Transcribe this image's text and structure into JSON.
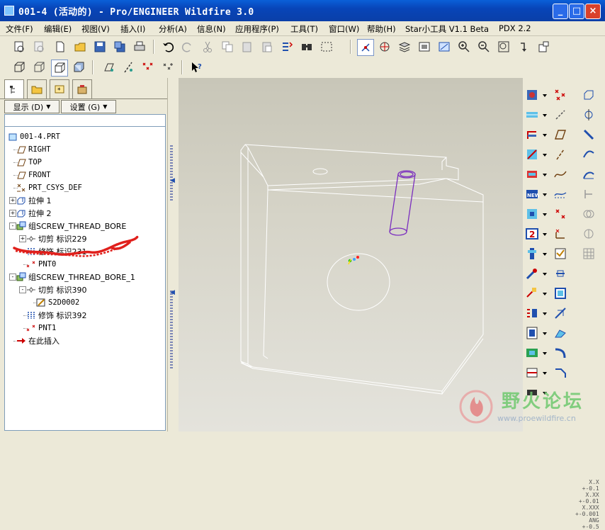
{
  "window": {
    "title": "001-4 (活动的) - Pro/ENGINEER Wildfire 3.0",
    "minimize": "_",
    "maximize": "□",
    "close": "×"
  },
  "menu": [
    "文件(F)",
    "编辑(E)",
    "视图(V)",
    "插入(I)",
    "分析(A)",
    "信息(N)",
    "应用程序(P)",
    "工具(T)",
    "窗口(W)",
    "帮助(H)",
    "Star小工具 V1.1 Beta",
    "PDX 2.2"
  ],
  "panel": {
    "show_label": "显示 (D)",
    "settings_label": "设置 (G)"
  },
  "tree": [
    {
      "label": "001-4.PRT",
      "icon": "part-icon",
      "level": 0
    },
    {
      "label": "RIGHT",
      "icon": "datum-plane-icon",
      "level": 1
    },
    {
      "label": "TOP",
      "icon": "datum-plane-icon",
      "level": 1
    },
    {
      "label": "FRONT",
      "icon": "datum-plane-icon",
      "level": 1
    },
    {
      "label": "PRT_CSYS_DEF",
      "icon": "csys-icon",
      "level": 1
    },
    {
      "label": "拉伸 1",
      "icon": "extrude-icon",
      "level": 1,
      "expand": "+"
    },
    {
      "label": "拉伸 2",
      "icon": "extrude-icon",
      "level": 1,
      "expand": "+"
    },
    {
      "label": "组SCREW_THREAD_BORE",
      "icon": "group-icon",
      "level": 1,
      "expand": "-"
    },
    {
      "label": "切剪 标识229",
      "icon": "cut-icon",
      "level": 2,
      "expand": "+"
    },
    {
      "label": "修饰 标识231",
      "icon": "cosmetic-icon",
      "level": 2
    },
    {
      "label": "PNT0",
      "icon": "point-icon",
      "level": 2
    },
    {
      "label": "组SCREW_THREAD_BORE_1",
      "icon": "group-icon",
      "level": 1,
      "expand": "-"
    },
    {
      "label": "切剪 标识390",
      "icon": "cut-icon",
      "level": 2,
      "expand": "-"
    },
    {
      "label": "S2D0002",
      "icon": "sketch-icon",
      "level": 3
    },
    {
      "label": "修饰 标识392",
      "icon": "cosmetic-icon",
      "level": 2
    },
    {
      "label": "PNT1",
      "icon": "point-icon",
      "level": 2
    },
    {
      "label": "在此插入",
      "icon": "insert-here-arrow-icon",
      "level": 1
    }
  ],
  "viewport": {
    "tolerances": [
      "X.X +-0.1",
      "X.XX +-0.01",
      "X.XXX +-0.001",
      "ANG +-0.5"
    ]
  },
  "watermark": {
    "text": "野火论坛",
    "url": "www.proewildfire.cn"
  },
  "colors": {
    "titlebar": "#0A5FD8",
    "model_edges": "#ffffff",
    "hole_edges": "#7b2fbf",
    "annotation_scribble": "#e0201c"
  }
}
